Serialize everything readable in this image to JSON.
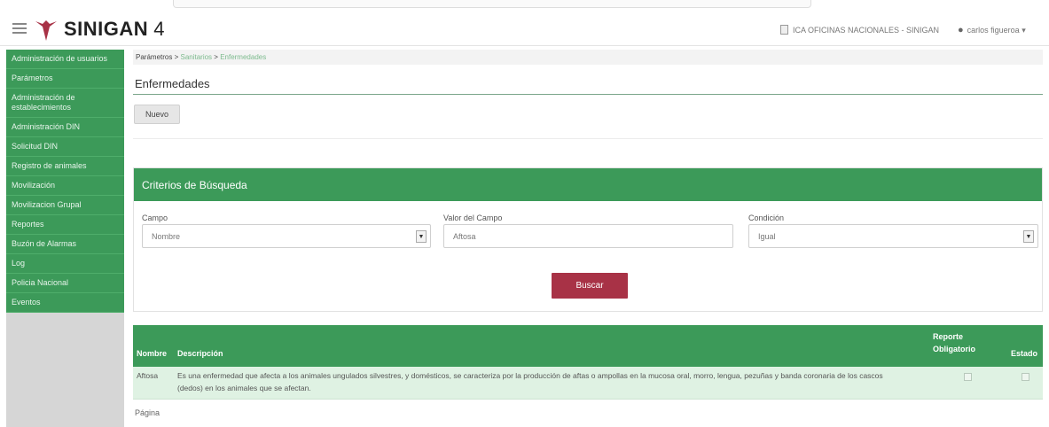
{
  "header": {
    "brand": "SINIGAN",
    "version": "4",
    "office": "ICA OFICINAS NACIONALES - SINIGAN",
    "user": "carlos figueroa ▾"
  },
  "sidebar": {
    "items": [
      {
        "label": "Administración de usuarios"
      },
      {
        "label": "Parámetros"
      },
      {
        "label": "Administración de establecimientos"
      },
      {
        "label": "Administración DIN"
      },
      {
        "label": "Solicitud DIN"
      },
      {
        "label": "Registro de animales"
      },
      {
        "label": "Movilización"
      },
      {
        "label": "Movilizacion Grupal"
      },
      {
        "label": "Reportes"
      },
      {
        "label": "Buzón de Alarmas"
      },
      {
        "label": "Log"
      },
      {
        "label": "Policia Nacional"
      },
      {
        "label": "Eventos"
      }
    ]
  },
  "breadcrumb": {
    "root": "Parámetros",
    "sep": " > ",
    "level1": "Sanitarios",
    "level2": "Enfermedades"
  },
  "page": {
    "title": "Enfermedades",
    "new_button": "Nuevo"
  },
  "criteria": {
    "title": "Criterios de Búsqueda",
    "campo_label": "Campo",
    "campo_value": "Nombre",
    "valor_label": "Valor del Campo",
    "valor_value": "Aftosa",
    "condicion_label": "Condición",
    "condicion_value": "Igual",
    "search_button": "Buscar"
  },
  "results": {
    "columns": {
      "nombre": "Nombre",
      "descripcion": "Descripción",
      "reporte_1": "Reporte",
      "reporte_2": "Obligatorio",
      "estado": "Estado"
    },
    "rows": [
      {
        "nombre": "Aftosa",
        "descripcion_1": "Es una enfermedad que afecta a los animales ungulados silvestres, y domésticos, se caracteriza por la producción de aftas o ampollas en la mucosa oral, morro, lengua, pezuñas y banda coronaria de los cascos",
        "descripcion_2": "(dedos) en los animales que se afectan."
      }
    ],
    "pager": "Página"
  },
  "colors": {
    "green": "#3c9a59",
    "maroon": "#a83246"
  }
}
